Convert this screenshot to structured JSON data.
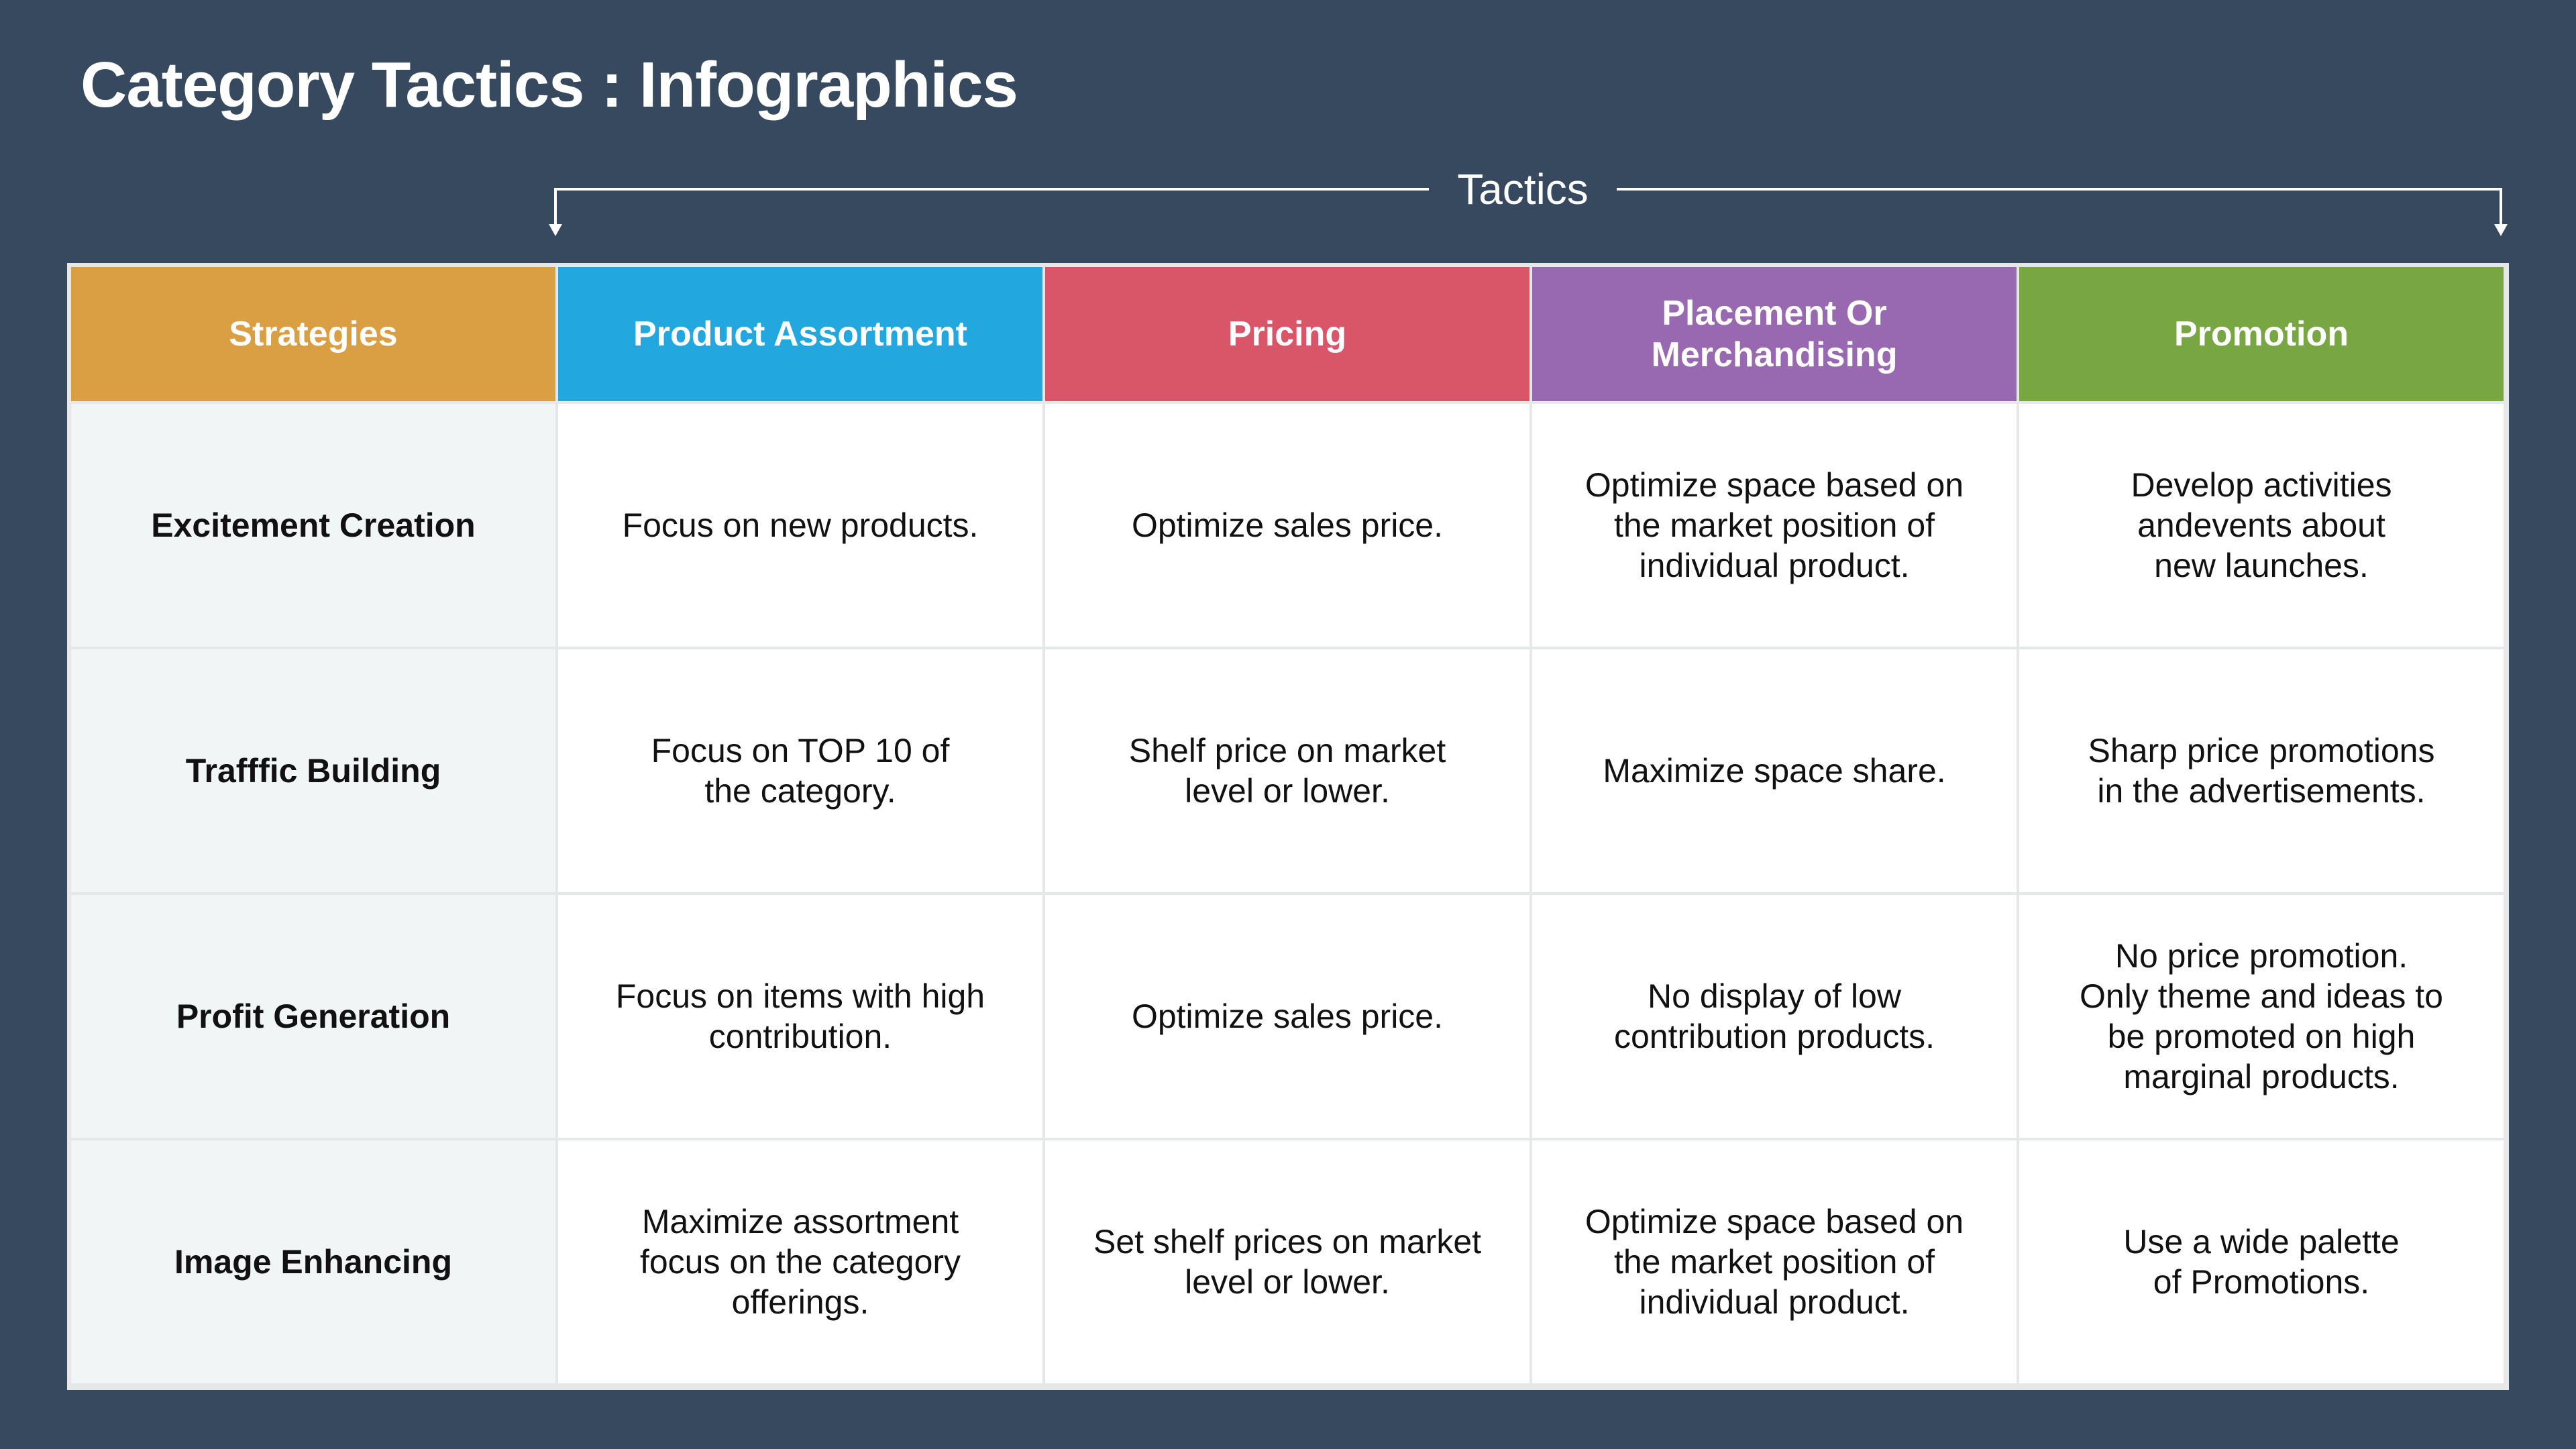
{
  "title": "Category Tactics : Infographics",
  "tactics_label": "Tactics",
  "colors": {
    "background": "#36495e",
    "strategies": "#da9f42",
    "product_assortment": "#22a8df",
    "pricing": "#d95668",
    "placement": "#9869b0",
    "promotion": "#78a643",
    "row_header_bg": "#f2f5f6",
    "grid_border": "#e6e8e8"
  },
  "headers": [
    {
      "label": "Strategies",
      "color": "#da9f42"
    },
    {
      "label": "Product Assortment",
      "color": "#22a8df"
    },
    {
      "label": "Pricing",
      "color": "#d95668"
    },
    {
      "label": "Placement Or\nMerchandising",
      "color": "#9869b0"
    },
    {
      "label": "Promotion",
      "color": "#78a643"
    }
  ],
  "rows": [
    {
      "strategy": "Excitement Creation",
      "cells": [
        "Focus on new products.",
        "Optimize sales price.",
        "Optimize space based on\nthe market position of\nindividual product.",
        "Develop activities\nandevents about\nnew launches."
      ]
    },
    {
      "strategy": "Trafffic Building",
      "cells": [
        "Focus on TOP 10 of\nthe category.",
        "Shelf price on market\nlevel or lower.",
        "Maximize space share.",
        "Sharp price promotions\nin the advertisements."
      ]
    },
    {
      "strategy": "Profit Generation",
      "cells": [
        "Focus on items with high\ncontribution.",
        "Optimize sales price.",
        "No display of low\ncontribution products.",
        "No price promotion.\nOnly theme and ideas to\nbe promoted on high\nmarginal products."
      ]
    },
    {
      "strategy": "Image Enhancing",
      "cells": [
        "Maximize assortment\nfocus on the category\nofferings.",
        "Set shelf prices on market\nlevel or lower.",
        "Optimize space based on\nthe market position of\nindividual product.",
        "Use a wide palette\nof Promotions."
      ]
    }
  ]
}
